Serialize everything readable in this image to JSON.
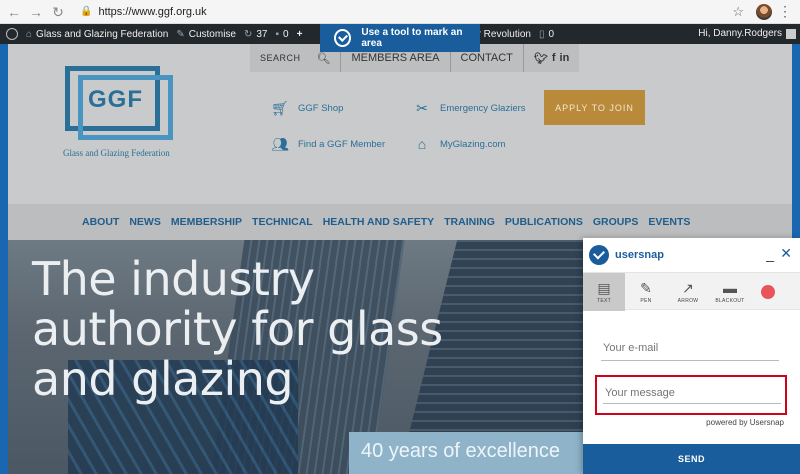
{
  "browser": {
    "url": "https://www.ggf.org.uk"
  },
  "wpbar": {
    "site_name": "Glass and Glazing Federation",
    "customise": "Customise",
    "updates_count": "37",
    "comments_count": "0",
    "plugin_label": "der Revolution",
    "plugin_count": "0",
    "greeting": "Hi, Danny.Rodgers"
  },
  "tooltip": {
    "text": "Use a tool to mark an area"
  },
  "site": {
    "topnav": {
      "search": "SEARCH",
      "members": "MEMBERS AREA",
      "contact": "CONTACT"
    },
    "logo": {
      "text": "GGF",
      "subtitle": "Glass and Glazing Federation"
    },
    "quick_links": {
      "shop": "GGF Shop",
      "emergency": "Emergency Glaziers",
      "find_member": "Find a GGF Member",
      "myglazing": "MyGlazing.com"
    },
    "apply": "APPLY TO JOIN",
    "main_nav": [
      "ABOUT",
      "NEWS",
      "MEMBERSHIP",
      "TECHNICAL",
      "HEALTH AND SAFETY",
      "TRAINING",
      "PUBLICATIONS",
      "GROUPS",
      "EVENTS"
    ]
  },
  "hero": {
    "line1": "The industry",
    "line2": "authority for glass",
    "line3": "and glazing",
    "banner": "40 years of excellence"
  },
  "usersnap": {
    "brand": "usersnap",
    "tools": {
      "text": "TEXT",
      "pen": "PEN",
      "arrow": "ARROW",
      "blackout": "BLACKOUT"
    },
    "email_placeholder": "Your e-mail",
    "message_placeholder": "Your message",
    "powered": "powered by Usersnap",
    "send": "SEND"
  }
}
